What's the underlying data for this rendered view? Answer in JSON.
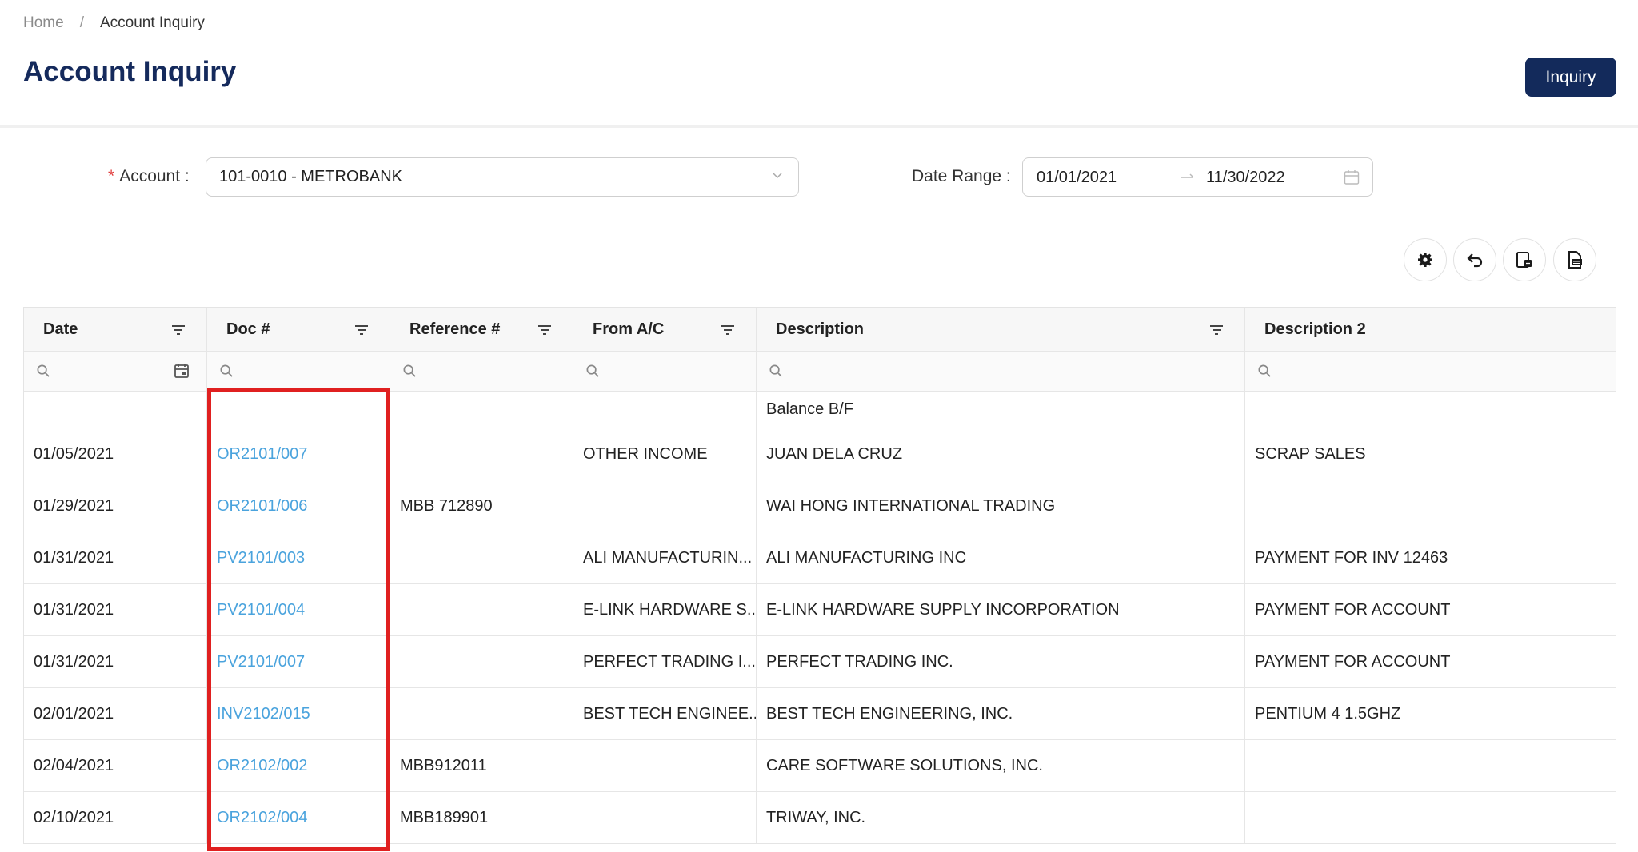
{
  "breadcrumb": {
    "home": "Home",
    "separator": "/",
    "current": "Account Inquiry"
  },
  "page": {
    "title": "Account Inquiry",
    "inquiry_button": "Inquiry"
  },
  "filters": {
    "account_label": "Account :",
    "account_required_mark": "*",
    "account_value": "101-0010 - METROBANK",
    "date_range_label": "Date Range :",
    "date_from": "01/01/2021",
    "date_to": "11/30/2022"
  },
  "toolbar": [
    "settings-icon",
    "undo-icon",
    "export-layout-icon",
    "export-file-icon"
  ],
  "table": {
    "columns": [
      "Date",
      "Doc #",
      "Reference #",
      "From A/C",
      "Description",
      "Description 2"
    ],
    "rows": [
      {
        "date": "",
        "doc": "",
        "ref": "",
        "from": "",
        "desc": "Balance B/F",
        "desc2": ""
      },
      {
        "date": "01/05/2021",
        "doc": "OR2101/007",
        "ref": "",
        "from": "OTHER INCOME",
        "desc": "JUAN DELA CRUZ",
        "desc2": "SCRAP SALES"
      },
      {
        "date": "01/29/2021",
        "doc": "OR2101/006",
        "ref": "MBB 712890",
        "from": "",
        "desc": "WAI HONG INTERNATIONAL TRADING",
        "desc2": ""
      },
      {
        "date": "01/31/2021",
        "doc": "PV2101/003",
        "ref": "",
        "from": "ALI MANUFACTURIN...",
        "desc": "ALI MANUFACTURING INC",
        "desc2": "PAYMENT FOR INV 12463"
      },
      {
        "date": "01/31/2021",
        "doc": "PV2101/004",
        "ref": "",
        "from": "E-LINK HARDWARE S...",
        "desc": "E-LINK HARDWARE SUPPLY INCORPORATION",
        "desc2": "PAYMENT FOR ACCOUNT"
      },
      {
        "date": "01/31/2021",
        "doc": "PV2101/007",
        "ref": "",
        "from": "PERFECT TRADING I...",
        "desc": "PERFECT TRADING INC.",
        "desc2": "PAYMENT FOR ACCOUNT"
      },
      {
        "date": "02/01/2021",
        "doc": "INV2102/015",
        "ref": "",
        "from": "BEST TECH ENGINEE...",
        "desc": "BEST TECH ENGINEERING, INC.",
        "desc2": "PENTIUM 4 1.5GHZ"
      },
      {
        "date": "02/04/2021",
        "doc": "OR2102/002",
        "ref": "MBB912011",
        "from": "",
        "desc": "CARE SOFTWARE SOLUTIONS, INC.",
        "desc2": ""
      },
      {
        "date": "02/10/2021",
        "doc": "OR2102/004",
        "ref": "MBB189901",
        "from": "",
        "desc": "TRIWAY, INC.",
        "desc2": ""
      }
    ]
  },
  "colors": {
    "primary": "#132a5b",
    "link": "#4aa3dd",
    "highlight": "#e02020"
  }
}
